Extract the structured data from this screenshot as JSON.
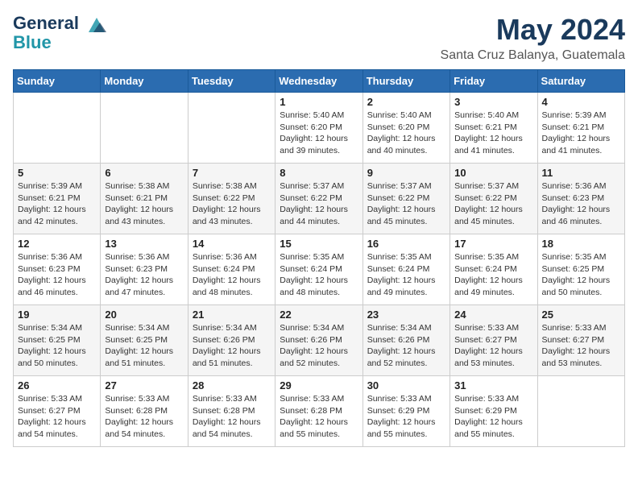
{
  "logo": {
    "line1": "General",
    "line2": "Blue"
  },
  "title": "May 2024",
  "location": "Santa Cruz Balanya, Guatemala",
  "days_header": [
    "Sunday",
    "Monday",
    "Tuesday",
    "Wednesday",
    "Thursday",
    "Friday",
    "Saturday"
  ],
  "weeks": [
    [
      {
        "day": "",
        "info": ""
      },
      {
        "day": "",
        "info": ""
      },
      {
        "day": "",
        "info": ""
      },
      {
        "day": "1",
        "info": "Sunrise: 5:40 AM\nSunset: 6:20 PM\nDaylight: 12 hours\nand 39 minutes."
      },
      {
        "day": "2",
        "info": "Sunrise: 5:40 AM\nSunset: 6:20 PM\nDaylight: 12 hours\nand 40 minutes."
      },
      {
        "day": "3",
        "info": "Sunrise: 5:40 AM\nSunset: 6:21 PM\nDaylight: 12 hours\nand 41 minutes."
      },
      {
        "day": "4",
        "info": "Sunrise: 5:39 AM\nSunset: 6:21 PM\nDaylight: 12 hours\nand 41 minutes."
      }
    ],
    [
      {
        "day": "5",
        "info": "Sunrise: 5:39 AM\nSunset: 6:21 PM\nDaylight: 12 hours\nand 42 minutes."
      },
      {
        "day": "6",
        "info": "Sunrise: 5:38 AM\nSunset: 6:21 PM\nDaylight: 12 hours\nand 43 minutes."
      },
      {
        "day": "7",
        "info": "Sunrise: 5:38 AM\nSunset: 6:22 PM\nDaylight: 12 hours\nand 43 minutes."
      },
      {
        "day": "8",
        "info": "Sunrise: 5:37 AM\nSunset: 6:22 PM\nDaylight: 12 hours\nand 44 minutes."
      },
      {
        "day": "9",
        "info": "Sunrise: 5:37 AM\nSunset: 6:22 PM\nDaylight: 12 hours\nand 45 minutes."
      },
      {
        "day": "10",
        "info": "Sunrise: 5:37 AM\nSunset: 6:22 PM\nDaylight: 12 hours\nand 45 minutes."
      },
      {
        "day": "11",
        "info": "Sunrise: 5:36 AM\nSunset: 6:23 PM\nDaylight: 12 hours\nand 46 minutes."
      }
    ],
    [
      {
        "day": "12",
        "info": "Sunrise: 5:36 AM\nSunset: 6:23 PM\nDaylight: 12 hours\nand 46 minutes."
      },
      {
        "day": "13",
        "info": "Sunrise: 5:36 AM\nSunset: 6:23 PM\nDaylight: 12 hours\nand 47 minutes."
      },
      {
        "day": "14",
        "info": "Sunrise: 5:36 AM\nSunset: 6:24 PM\nDaylight: 12 hours\nand 48 minutes."
      },
      {
        "day": "15",
        "info": "Sunrise: 5:35 AM\nSunset: 6:24 PM\nDaylight: 12 hours\nand 48 minutes."
      },
      {
        "day": "16",
        "info": "Sunrise: 5:35 AM\nSunset: 6:24 PM\nDaylight: 12 hours\nand 49 minutes."
      },
      {
        "day": "17",
        "info": "Sunrise: 5:35 AM\nSunset: 6:24 PM\nDaylight: 12 hours\nand 49 minutes."
      },
      {
        "day": "18",
        "info": "Sunrise: 5:35 AM\nSunset: 6:25 PM\nDaylight: 12 hours\nand 50 minutes."
      }
    ],
    [
      {
        "day": "19",
        "info": "Sunrise: 5:34 AM\nSunset: 6:25 PM\nDaylight: 12 hours\nand 50 minutes."
      },
      {
        "day": "20",
        "info": "Sunrise: 5:34 AM\nSunset: 6:25 PM\nDaylight: 12 hours\nand 51 minutes."
      },
      {
        "day": "21",
        "info": "Sunrise: 5:34 AM\nSunset: 6:26 PM\nDaylight: 12 hours\nand 51 minutes."
      },
      {
        "day": "22",
        "info": "Sunrise: 5:34 AM\nSunset: 6:26 PM\nDaylight: 12 hours\nand 52 minutes."
      },
      {
        "day": "23",
        "info": "Sunrise: 5:34 AM\nSunset: 6:26 PM\nDaylight: 12 hours\nand 52 minutes."
      },
      {
        "day": "24",
        "info": "Sunrise: 5:33 AM\nSunset: 6:27 PM\nDaylight: 12 hours\nand 53 minutes."
      },
      {
        "day": "25",
        "info": "Sunrise: 5:33 AM\nSunset: 6:27 PM\nDaylight: 12 hours\nand 53 minutes."
      }
    ],
    [
      {
        "day": "26",
        "info": "Sunrise: 5:33 AM\nSunset: 6:27 PM\nDaylight: 12 hours\nand 54 minutes."
      },
      {
        "day": "27",
        "info": "Sunrise: 5:33 AM\nSunset: 6:28 PM\nDaylight: 12 hours\nand 54 minutes."
      },
      {
        "day": "28",
        "info": "Sunrise: 5:33 AM\nSunset: 6:28 PM\nDaylight: 12 hours\nand 54 minutes."
      },
      {
        "day": "29",
        "info": "Sunrise: 5:33 AM\nSunset: 6:28 PM\nDaylight: 12 hours\nand 55 minutes."
      },
      {
        "day": "30",
        "info": "Sunrise: 5:33 AM\nSunset: 6:29 PM\nDaylight: 12 hours\nand 55 minutes."
      },
      {
        "day": "31",
        "info": "Sunrise: 5:33 AM\nSunset: 6:29 PM\nDaylight: 12 hours\nand 55 minutes."
      },
      {
        "day": "",
        "info": ""
      }
    ]
  ]
}
